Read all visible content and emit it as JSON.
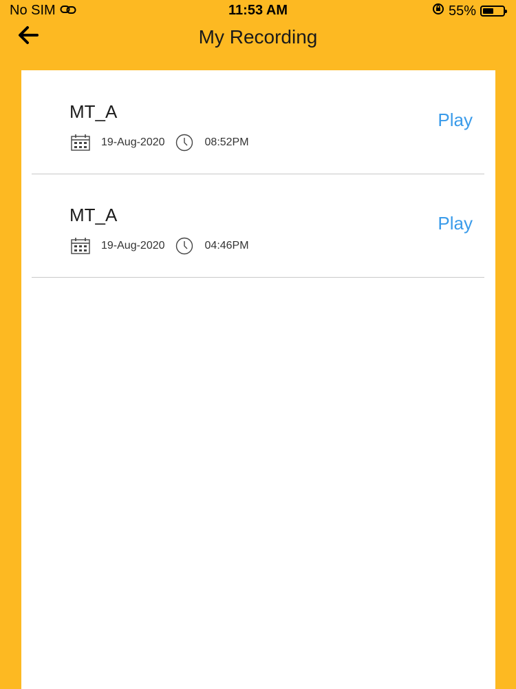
{
  "status_bar": {
    "carrier": "No SIM",
    "time": "11:53 AM",
    "battery_percent": "55%",
    "battery_level": 0.55
  },
  "nav": {
    "title": "My Recording"
  },
  "recordings": [
    {
      "name": "MT_A",
      "date": "19-Aug-2020",
      "time": "08:52PM",
      "action": "Play"
    },
    {
      "name": "MT_A",
      "date": "19-Aug-2020",
      "time": "04:46PM",
      "action": "Play"
    }
  ],
  "colors": {
    "background": "#FDB922",
    "accent": "#3A9BEA"
  },
  "icons": [
    "wifi-link-icon",
    "rotation-lock-icon",
    "battery-icon",
    "back-arrow-icon",
    "calendar-icon",
    "clock-icon"
  ]
}
